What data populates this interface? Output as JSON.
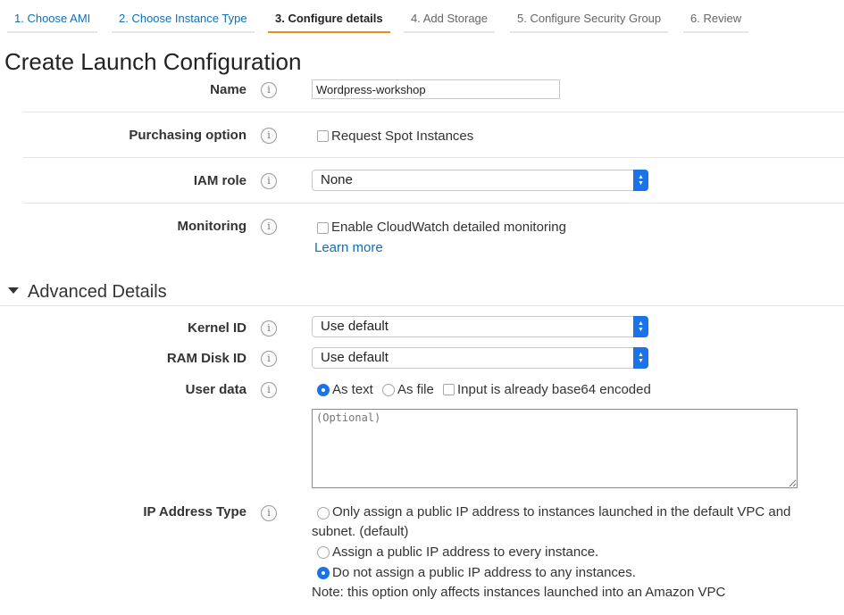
{
  "wizard": {
    "steps": [
      {
        "label": "1. Choose AMI"
      },
      {
        "label": "2. Choose Instance Type"
      },
      {
        "label": "3. Configure details"
      },
      {
        "label": "4. Add Storage"
      },
      {
        "label": "5. Configure Security Group"
      },
      {
        "label": "6. Review"
      }
    ]
  },
  "page": {
    "title": "Create Launch Configuration"
  },
  "form": {
    "name": {
      "label": "Name",
      "value": "Wordpress-workshop"
    },
    "purchasing": {
      "label": "Purchasing option",
      "checkbox_label": "Request Spot Instances",
      "checked": false
    },
    "iam_role": {
      "label": "IAM role",
      "selected": "None"
    },
    "monitoring": {
      "label": "Monitoring",
      "checkbox_label": "Enable CloudWatch detailed monitoring",
      "checked": false,
      "link": "Learn more"
    }
  },
  "advanced": {
    "heading": "Advanced Details",
    "kernel_id": {
      "label": "Kernel ID",
      "selected": "Use default"
    },
    "ram_disk_id": {
      "label": "RAM Disk ID",
      "selected": "Use default"
    },
    "user_data": {
      "label": "User data",
      "as_text": "As text",
      "as_file": "As file",
      "base64": "Input is already base64 encoded",
      "selected": "As text",
      "placeholder": "(Optional)"
    },
    "ip_address_type": {
      "label": "IP Address Type",
      "option1_line1": "Only assign a public IP address to instances launched in the default VPC and",
      "option1_line2": "subnet. (default)",
      "option2": "Assign a public IP address to every instance.",
      "option3": "Do not assign a public IP address to any instances.",
      "selected": "Do not assign a public IP address to any instances.",
      "note": "Note: this option only affects instances launched into an Amazon VPC"
    }
  },
  "colors": {
    "link": "#0f6fb7",
    "active_step": "#eb8c19",
    "select_accent": "#1a73e8"
  }
}
